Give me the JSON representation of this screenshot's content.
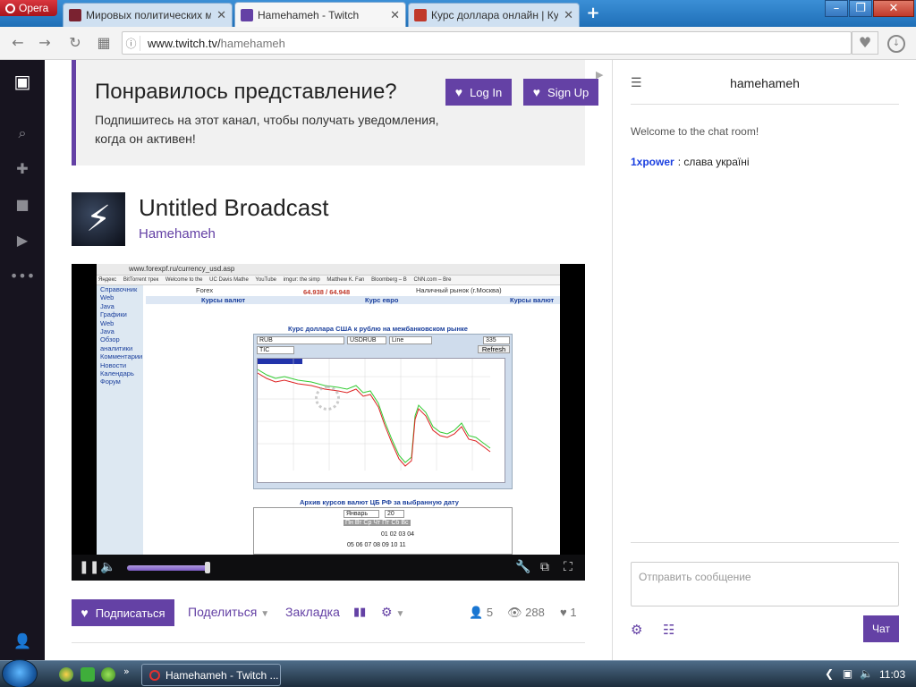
{
  "browser": {
    "menu_label": "Opera",
    "tabs": [
      {
        "title": "Мировых политических мно",
        "favicon_color": "#7a2230"
      },
      {
        "title": "Hamehameh - Twitch",
        "favicon_color": "#6441a5"
      },
      {
        "title": "Курс доллара онлайн | Курс",
        "favicon_color": "#c0392b"
      }
    ],
    "url_host": "www.twitch.tv/",
    "url_path": "hamehameh"
  },
  "promo": {
    "title": "Понравилось представление?",
    "subtitle": "Подпишитесь на этот канал, чтобы получать уведомления, когда он активен!",
    "login_label": "Log In",
    "signup_label": "Sign Up"
  },
  "broadcast": {
    "title": "Untitled Broadcast",
    "channel": "Hamehameh"
  },
  "video": {
    "address": "www.forexpf.ru/currency_usd.asp",
    "bookmarks": [
      "Яндекс",
      "BitTorrent трек",
      "Welcome to the",
      "UC Davis Mathe",
      "YouTube",
      "imgur: the simp",
      "Matthew K. Fan",
      "Bloomberg – B",
      "CNN.com – Bre"
    ],
    "left_menu": [
      "Справочник",
      "Web",
      "Java",
      "Графики",
      "Web",
      "Java",
      "Обзор аналитики",
      "Комментарии",
      "Новости",
      "Календарь",
      "Форум"
    ],
    "header_left": "Forex",
    "header_rate": "64.938 / 64.948",
    "header_right": "Наличный рынок (г.Москва)",
    "nav_items": [
      "Курсы валют",
      "Курс евро",
      "Курсы валют"
    ],
    "chart_title": "Курс доллара США к рублю на межбанковском рынке",
    "selects": [
      "RUB",
      "USDRUB",
      "Line",
      "335",
      "TIC"
    ],
    "refresh_label": "Refresh",
    "archive_title": "Архив курсов валют ЦБ РФ за выбранную дату",
    "archive_month": "Январь",
    "archive_year": "20",
    "archive_days_header": "Пн Вт Ср Чт Пт Сб Вс",
    "archive_row1": "01 02 03 04",
    "archive_row2": "05 06 07 08 09 10 11"
  },
  "actions": {
    "subscribe_label": "Подписаться",
    "share_label": "Поделиться",
    "bookmark_label": "Закладка",
    "viewers": "5",
    "views": "288",
    "follows": "1"
  },
  "chat": {
    "title": "hamehameh",
    "welcome": "Welcome to the chat room!",
    "messages": [
      {
        "user": "1xpower",
        "text": "слава україні"
      }
    ],
    "input_placeholder": "Отправить сообщение",
    "send_label": "Чат"
  },
  "taskbar": {
    "task_title": "Hamehameh - Twitch ...",
    "clock": "11:03"
  },
  "colors": {
    "twitch_purple": "#6441a5",
    "sidebar_dark": "#17141f"
  }
}
